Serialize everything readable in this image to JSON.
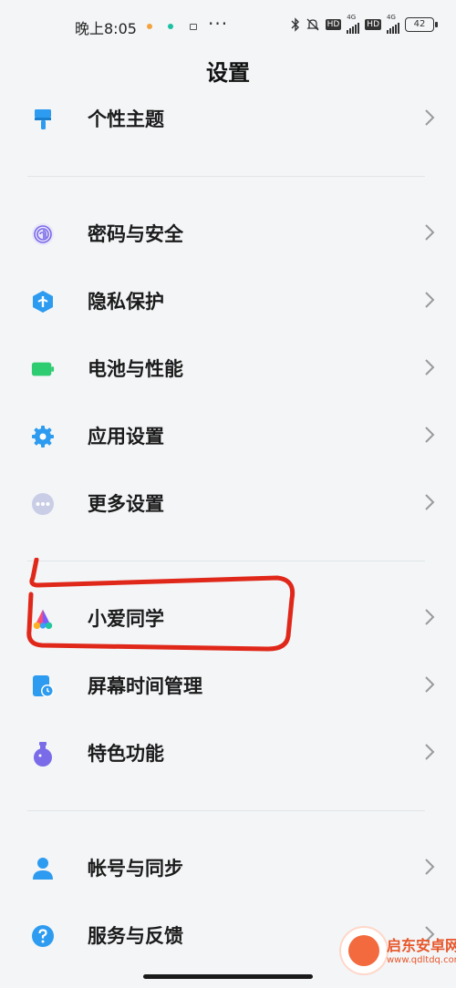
{
  "status_bar": {
    "time": "晚上8:05",
    "more": "···",
    "hd1": "HD",
    "hd2": "HD",
    "net1": "4G",
    "net2": "4G",
    "battery": "42"
  },
  "page": {
    "title": "设置"
  },
  "rows": [
    {
      "label": "个性主题",
      "icon": "paintbrush-icon"
    },
    {
      "label": "密码与安全",
      "icon": "fingerprint-icon"
    },
    {
      "label": "隐私保护",
      "icon": "privacy-shield-icon"
    },
    {
      "label": "电池与性能",
      "icon": "battery-icon"
    },
    {
      "label": "应用设置",
      "icon": "gear-icon"
    },
    {
      "label": "更多设置",
      "icon": "more-dots-icon"
    },
    {
      "label": "小爱同学",
      "icon": "xiaoai-icon"
    },
    {
      "label": "屏幕时间管理",
      "icon": "screen-time-icon"
    },
    {
      "label": "特色功能",
      "icon": "flask-icon"
    },
    {
      "label": "帐号与同步",
      "icon": "account-icon"
    },
    {
      "label": "服务与反馈",
      "icon": "help-icon"
    }
  ],
  "watermark": {
    "name": "启东安卓网",
    "url": "www.qdltdq.com"
  },
  "colors": {
    "background": "#f3f5f7",
    "accent_blue": "#2d9bf0",
    "battery_green": "#2ecc71",
    "annotation_red": "#e0281a"
  }
}
